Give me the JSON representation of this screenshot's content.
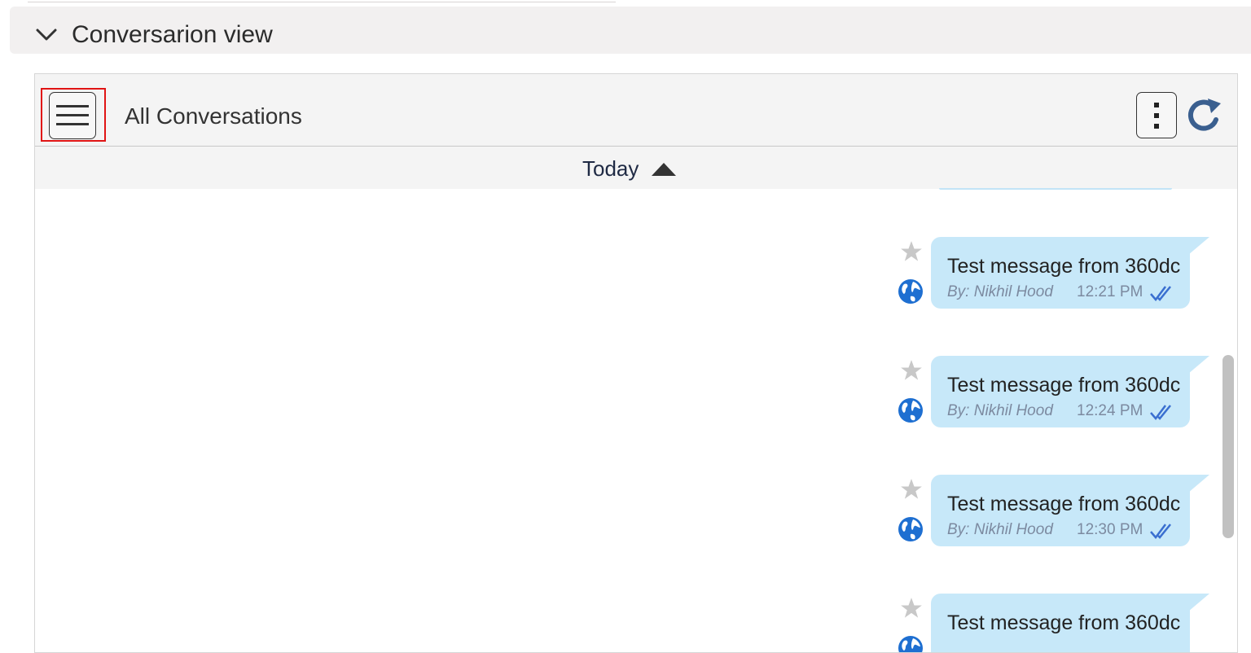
{
  "section": {
    "title": "Conversarion view",
    "toggle_icon": "chevron-down-icon"
  },
  "toolbar": {
    "title": "All Conversations",
    "menu_icon": "hamburger-menu-icon",
    "more_icon": "vertical-dots-icon",
    "refresh_icon": "refresh-icon"
  },
  "day_group": {
    "label": "Today",
    "caret_icon": "caret-up-icon"
  },
  "messages": [
    {
      "text": "Test message from 360dc",
      "author": "By: Nikhil Hood",
      "time": "12:21 PM",
      "status_icon": "double-check-icon"
    },
    {
      "text": "Test message from 360dc",
      "author": "By: Nikhil Hood",
      "time": "12:24 PM",
      "status_icon": "double-check-icon"
    },
    {
      "text": "Test message from 360dc",
      "author": "By: Nikhil Hood",
      "time": "12:30 PM",
      "status_icon": "double-check-icon"
    },
    {
      "text": "Test message from 360dc",
      "author": "",
      "time": "",
      "status_icon": "double-check-icon"
    }
  ],
  "colors": {
    "bubble": "#c7e8f9",
    "highlight": "#e01414",
    "globe": "#1e6fd1",
    "check": "#3a6fd0",
    "star": "#c8c8c8"
  }
}
